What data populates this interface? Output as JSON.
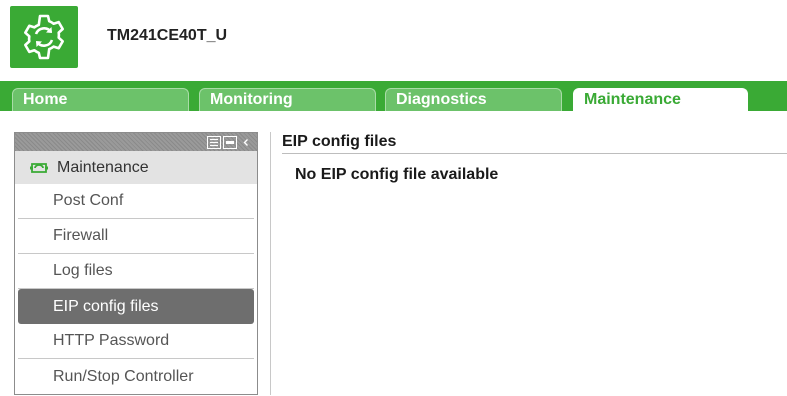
{
  "header": {
    "device_name": "TM241CE40T_U",
    "logo_icon": "gear-refresh-icon",
    "brand_color": "#3aaa35"
  },
  "tabs": [
    {
      "label": "Home",
      "active": false
    },
    {
      "label": "Monitoring",
      "active": false
    },
    {
      "label": "Diagnostics",
      "active": false
    },
    {
      "label": "Maintenance",
      "active": true
    }
  ],
  "sidebar": {
    "toolbar_icons": [
      "list-icon",
      "minus-icon",
      "collapse-left-icon"
    ],
    "header": {
      "label": "Maintenance",
      "icon": "maintenance-icon"
    },
    "items": [
      {
        "label": "Post Conf",
        "selected": false
      },
      {
        "label": "Firewall",
        "selected": false
      },
      {
        "label": "Log files",
        "selected": false
      },
      {
        "label": "EIP config files",
        "selected": true
      },
      {
        "label": "HTTP Password",
        "selected": false
      },
      {
        "label": "Run/Stop Controller",
        "selected": false
      }
    ]
  },
  "content": {
    "title": "EIP config files",
    "message": "No EIP config file available"
  }
}
